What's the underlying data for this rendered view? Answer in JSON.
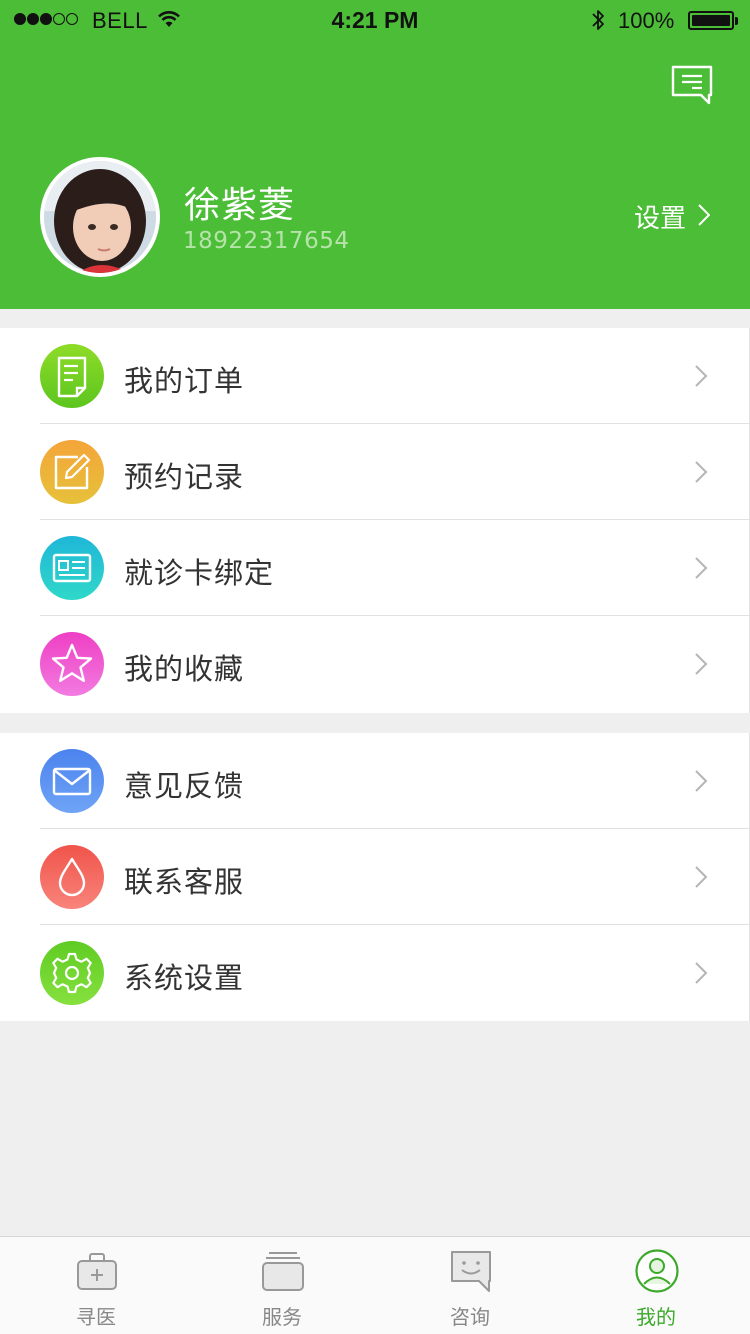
{
  "status_bar": {
    "carrier": "BELL",
    "time": "4:21 PM",
    "battery": "100%",
    "signal_strength": 3
  },
  "header": {
    "message_icon": "message-icon",
    "user": {
      "name": "徐紫菱",
      "phone": "18922317654"
    },
    "settings_label": "设置"
  },
  "menu_groups": [
    {
      "items": [
        {
          "label": "我的订单",
          "icon": "order-document-icon",
          "colors": [
            "#8fdc28",
            "#5cc51f"
          ]
        },
        {
          "label": "预约记录",
          "icon": "edit-note-icon",
          "colors": [
            "#f4a53a",
            "#e6c13a"
          ]
        },
        {
          "label": "就诊卡绑定",
          "icon": "id-card-icon",
          "colors": [
            "#1fb7d8",
            "#2fd8c8"
          ]
        },
        {
          "label": "我的收藏",
          "icon": "star-icon",
          "colors": [
            "#ee3fc4",
            "#f27be0"
          ]
        }
      ]
    },
    {
      "items": [
        {
          "label": "意见反馈",
          "icon": "mail-icon",
          "colors": [
            "#4b83ee",
            "#6fa4f6"
          ]
        },
        {
          "label": "联系客服",
          "icon": "droplet-icon",
          "colors": [
            "#f0544a",
            "#f8847b"
          ]
        },
        {
          "label": "系统设置",
          "icon": "gear-icon",
          "colors": [
            "#5fcc23",
            "#86e03e"
          ]
        }
      ]
    }
  ],
  "tabbar": {
    "tabs": [
      {
        "label": "寻医",
        "icon": "medical-kit-icon",
        "active": false
      },
      {
        "label": "服务",
        "icon": "cards-stack-icon",
        "active": false
      },
      {
        "label": "咨询",
        "icon": "chat-smile-icon",
        "active": false
      },
      {
        "label": "我的",
        "icon": "user-profile-icon",
        "active": true
      }
    ]
  },
  "colors": {
    "brand_green": "#4cbd37",
    "tab_active": "#3da92b",
    "tab_inactive": "#888888",
    "background": "#efefef"
  }
}
